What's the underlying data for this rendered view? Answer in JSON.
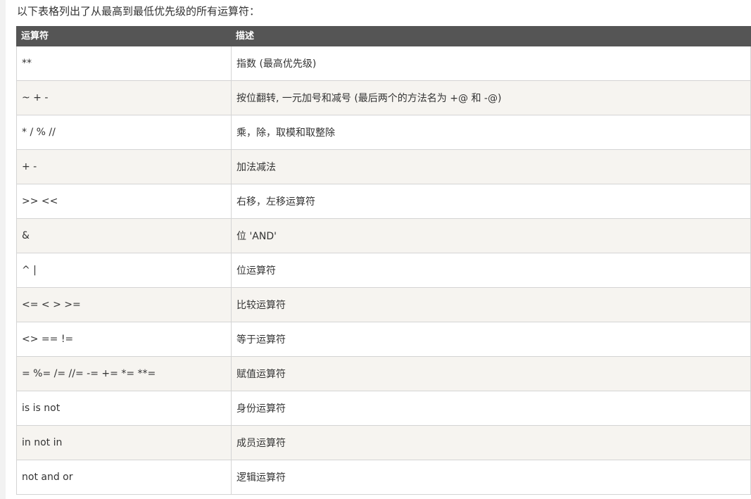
{
  "intro_text": "以下表格列出了从最高到最低优先级的所有运算符：",
  "table": {
    "headers": [
      "运算符",
      "描述"
    ],
    "rows": [
      {
        "operator": "**",
        "description": "指数 (最高优先级)"
      },
      {
        "operator": "~ + -",
        "description": "按位翻转, 一元加号和减号 (最后两个的方法名为 +@ 和 -@)"
      },
      {
        "operator": "* / % //",
        "description": "乘，除，取模和取整除"
      },
      {
        "operator": "+ -",
        "description": "加法减法"
      },
      {
        "operator": ">> <<",
        "description": "右移，左移运算符"
      },
      {
        "operator": "&",
        "description": "位 'AND'"
      },
      {
        "operator": "^ |",
        "description": "位运算符"
      },
      {
        "operator": "<= < > >=",
        "description": "比较运算符"
      },
      {
        "operator": "<> == !=",
        "description": "等于运算符"
      },
      {
        "operator": "= %= /= //= -= += *= **=",
        "description": "赋值运算符"
      },
      {
        "operator": "is is not",
        "description": "身份运算符"
      },
      {
        "operator": "in not in",
        "description": "成员运算符"
      },
      {
        "operator": "not and or",
        "description": "逻辑运算符"
      }
    ]
  },
  "colors": {
    "header_bg": "#555555",
    "header_text": "#ffffff",
    "row_alt_bg": "#f6f4f0",
    "border": "#d4d4d4",
    "text": "#333333"
  }
}
